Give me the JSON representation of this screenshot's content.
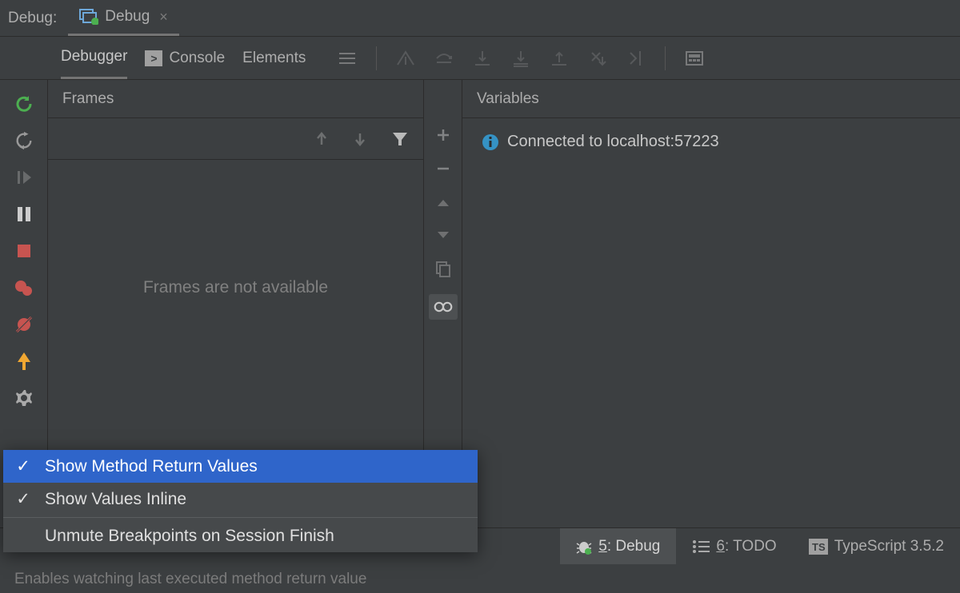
{
  "top": {
    "panel_label": "Debug:",
    "tab_label": "Debug"
  },
  "debugger_tabs": {
    "debugger": "Debugger",
    "console": "Console",
    "elements": "Elements"
  },
  "frames": {
    "title": "Frames",
    "empty_msg": "Frames are not available"
  },
  "variables": {
    "title": "Variables",
    "connected_msg": "Connected to localhost:57223"
  },
  "context_menu": {
    "item1": "Show Method Return Values",
    "item2": "Show Values Inline",
    "item3": "Unmute Breakpoints on Session Finish"
  },
  "status": {
    "debug_key": "5",
    "debug_label": ": Debug",
    "todo_key": "6",
    "todo_label": ": TODO",
    "ts_label": "TypeScript 3.5.2"
  },
  "hint": "Enables watching last executed method return value"
}
